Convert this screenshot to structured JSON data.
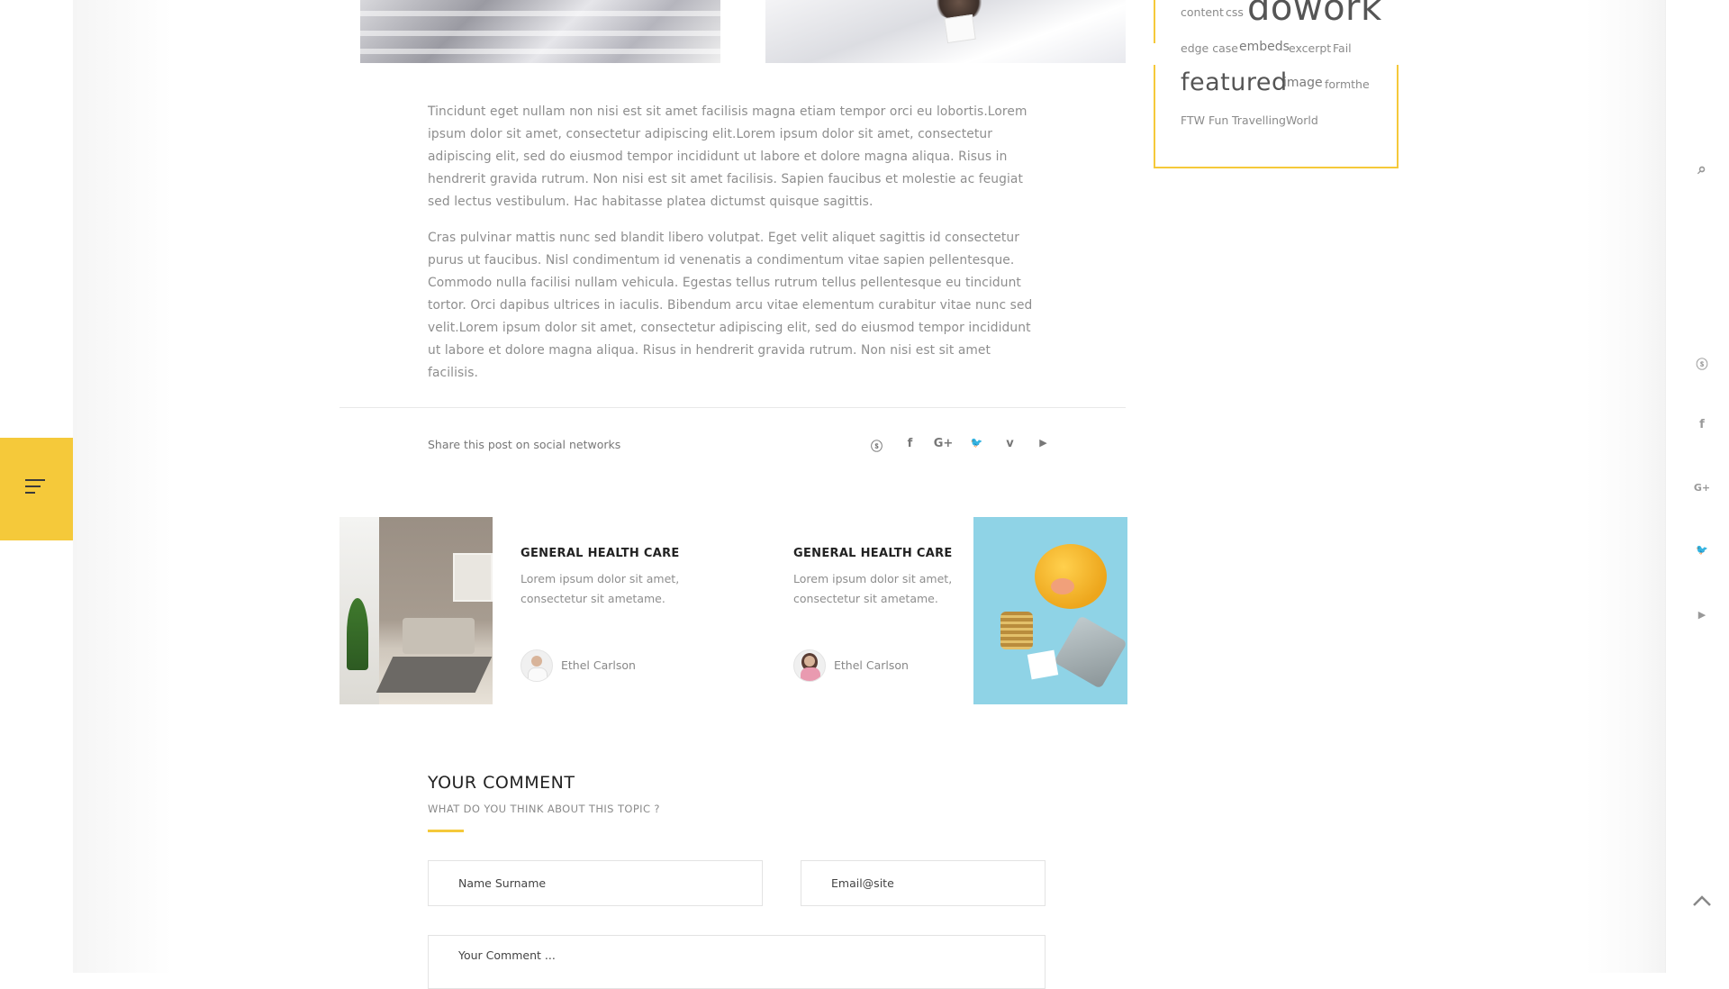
{
  "article": {
    "paragraphs": [
      "Tincidunt eget nullam non nisi est sit amet facilisis magna etiam tempor orci eu lobortis.Lorem ipsum dolor sit amet, consectetur adipiscing elit.Lorem ipsum dolor sit amet, consectetur adipiscing elit, sed do eiusmod tempor incididunt ut labore et dolore magna aliqua. Risus in hendrerit gravida rutrum. Non nisi est sit amet facilisis. Sapien faucibus et molestie ac feugiat sed lectus vestibulum. Hac habitasse platea dictumst quisque sagittis.",
      "Cras pulvinar mattis nunc sed blandit libero volutpat. Eget velit aliquet sagittis id consectetur purus ut faucibus. Nisl condimentum id venenatis a condimentum vitae sapien pellentesque. Commodo nulla facilisi nullam vehicula. Egestas tellus rutrum tellus pellentesque eu tincidunt tortor. Orci dapibus ultrices in iaculis. Bibendum arcu vitae elementum curabitur vitae nunc sed velit.Lorem ipsum dolor sit amet, consectetur adipiscing elit, sed do eiusmod tempor incididunt ut labore et dolore magna aliqua. Risus in hendrerit gravida rutrum. Non nisi est sit amet facilisis."
    ]
  },
  "share": {
    "label": "Share this post on social networks",
    "icons": [
      {
        "name": "skype-icon",
        "glyph": "ⓢ"
      },
      {
        "name": "facebook-icon",
        "glyph": "f"
      },
      {
        "name": "google-plus-icon",
        "glyph": "G+"
      },
      {
        "name": "twitter-icon",
        "glyph": "🐦"
      },
      {
        "name": "vimeo-icon",
        "glyph": "v"
      },
      {
        "name": "youtube-icon",
        "glyph": "▶"
      }
    ]
  },
  "related": [
    {
      "title": "GENERAL HEALTH CARE",
      "excerpt": "Lorem ipsum dolor sit amet, consectetur sit ametame.",
      "author": "Ethel Carlson"
    },
    {
      "title": "GENERAL HEALTH CARE",
      "excerpt": "Lorem ipsum dolor sit amet, consectetur sit ametame.",
      "author": "Ethel Carlson"
    }
  ],
  "comment": {
    "title": "YOUR COMMENT",
    "subtitle": "WHAT DO YOU THINK ABOUT THIS TOPIC ?",
    "name_placeholder": "Name Surname",
    "email_placeholder": "Email@site",
    "comment_placeholder": "Your Comment ..."
  },
  "tags": {
    "content": "content",
    "css": "css",
    "dowork": "dowork",
    "edge_case": "edge case",
    "embeds": "embeds",
    "excerpt": "excerpt",
    "fail": "Fail",
    "featured": "featured",
    "image": "image",
    "formthe": "formthe",
    "ftw": "FTW",
    "fun": "Fun",
    "travelling": "Travelling",
    "world": "World"
  },
  "rail": {
    "search": "⌕",
    "skype": "ⓢ",
    "facebook": "f",
    "google_plus": "G+",
    "twitter": "🐦",
    "youtube": "▶"
  },
  "colors": {
    "accent": "#f5c93a",
    "text": "#8e8e8e",
    "heading": "#222222"
  }
}
